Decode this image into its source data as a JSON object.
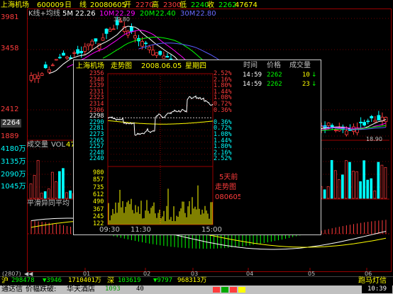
{
  "header": {
    "stock_name": "上海机场",
    "code": "600009",
    "period": "日",
    "chart_type": "线",
    "date": "20080605",
    "open_label": "开",
    "open": "2270",
    "high_label": "高",
    "high": "2300",
    "low_label": "低",
    "low": "2240",
    "close_label": "收",
    "close": "2262",
    "volume": "47674"
  },
  "ma_bar": {
    "title": "K线+均线",
    "items": [
      {
        "label": "5M",
        "value": "22.26",
        "color": "#ffffff"
      },
      {
        "label": "10M",
        "value": "22.29",
        "color": "#ff00ff"
      },
      {
        "label": "20M",
        "value": "22.40",
        "color": "#00ff00"
      },
      {
        "label": "30M",
        "value": "22.80",
        "color": "#5a5aff"
      }
    ]
  },
  "price_axis": [
    "3981",
    "3458",
    "2412",
    "2264",
    "1889"
  ],
  "chart_marks": {
    "peak": "39.80",
    "low": "18.90"
  },
  "volume_panel": {
    "title": "成交量",
    "indicator": "VOL",
    "value": "47",
    "axis": [
      "4180万",
      "3135万",
      "2090万",
      "1045万"
    ]
  },
  "macd_panel": {
    "title": "平滑异同平均"
  },
  "time_axis": {
    "start": "(2807)",
    "ticks": [
      "01",
      "02",
      "03",
      "04",
      "05",
      "06"
    ]
  },
  "popup": {
    "title": "上海机场",
    "subtitle": "走势图",
    "date": "2008.06.05",
    "weekday": "星期四",
    "price_ticks": [
      {
        "price": "2356",
        "pct": "2.52%"
      },
      {
        "price": "2348",
        "pct": "2.16%"
      },
      {
        "price": "2339",
        "pct": "1.80%"
      },
      {
        "price": "2331",
        "pct": "1.44%"
      },
      {
        "price": "2323",
        "pct": "1.08%"
      },
      {
        "price": "2314",
        "pct": "0.72%"
      },
      {
        "price": "2306",
        "pct": "0.36%"
      },
      {
        "price": "2298",
        "pct": ""
      },
      {
        "price": "2290",
        "pct": "0.36%"
      },
      {
        "price": "2281",
        "pct": "0.72%"
      },
      {
        "price": "2273",
        "pct": "1.08%"
      },
      {
        "price": "2265",
        "pct": "1.44%"
      },
      {
        "price": "2257",
        "pct": "1.80%"
      },
      {
        "price": "2248",
        "pct": "2.16%"
      },
      {
        "price": "2240",
        "pct": "2.52%"
      }
    ],
    "volume_ticks": [
      "980",
      "857",
      "735",
      "612",
      "490",
      "367",
      "245",
      "122"
    ],
    "time_labels": [
      "09:30",
      "11:30",
      "15:00"
    ],
    "note_line1": "5天前",
    "note_line2": "走势图",
    "note_code": "080605"
  },
  "quote": {
    "headers": [
      "时间",
      "价格",
      "成交量"
    ],
    "rows": [
      {
        "time": "14:59",
        "price": "2262",
        "volume": "10",
        "arrow": "↓"
      },
      {
        "time": "14:59",
        "price": "2262",
        "volume": "23",
        "arrow": "↓"
      }
    ]
  },
  "status1": {
    "sh_label": "沪",
    "sh_index": "298478",
    "sh_change": "▼3946",
    "sh_amount": "1710401万",
    "sz_label": "深",
    "sz_index": "103619",
    "sz_change": "▼9797",
    "sz_amount": "968313万",
    "right_label": "跑马灯信"
  },
  "status2": {
    "app": "通达信",
    "ranking": "价幅跌破:",
    "stock": "华天酒店",
    "price": "1093",
    "vol": "40",
    "time": "10:39"
  },
  "colors": {
    "up": "#ff3c3c",
    "down": "#00ffff",
    "axis": "#9a0000",
    "yellow": "#ffff00"
  }
}
